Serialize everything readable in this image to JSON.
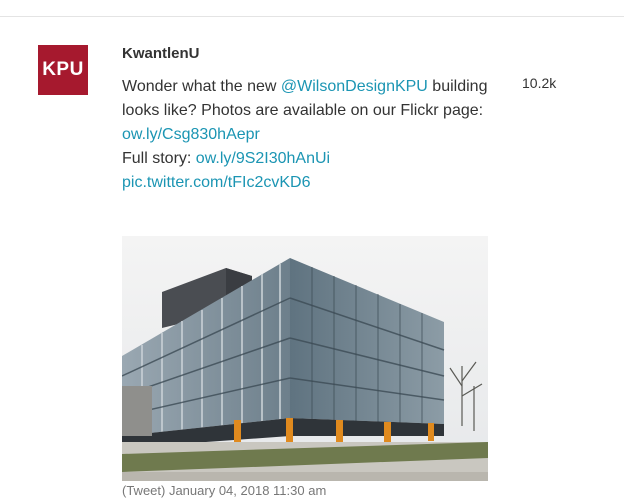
{
  "tweet": {
    "author": "KwantlenU",
    "avatar_text": "KPU",
    "text_1": "Wonder what the new ",
    "mention": "@WilsonDesignKPU",
    "text_2": " building looks like? Photos are available on our Flickr page: ",
    "link_flickr": "ow.ly/Csg830hAepr",
    "text_3": "Full story: ",
    "link_story": "ow.ly/9S2I30hAnUi",
    "link_pic": "pic.twitter.com/tFIc2cvKD6",
    "metric": "10.2k",
    "timestamp": "(Tweet) January 04, 2018 11:30 am"
  },
  "colors": {
    "brand": "#a6192e",
    "link": "#1b95b3",
    "text": "#333333",
    "muted": "#777777"
  }
}
